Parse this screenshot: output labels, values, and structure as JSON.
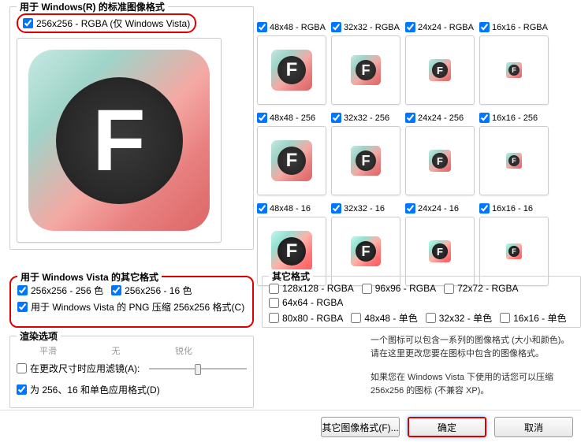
{
  "sections": {
    "standard": "用于 Windows(R) 的标准图像格式",
    "vista_other": "用于 Windows Vista 的其它格式",
    "other": "其它格式",
    "render": "渲染选项"
  },
  "checks": {
    "c256rgba": "256x256 - RGBA (仅 Windows Vista)",
    "c48rgba": "48x48 - RGBA",
    "c32rgba": "32x32 - RGBA",
    "c24rgba": "24x24 - RGBA",
    "c16rgba": "16x16 - RGBA",
    "c48_256": "48x48 - 256",
    "c32_256": "32x32 - 256",
    "c24_256": "24x24 - 256",
    "c16_256": "16x16 - 256",
    "c48_16": "48x48 - 16",
    "c32_16": "32x32 - 16",
    "c24_16": "24x24 - 16",
    "c16_16": "16x16 - 16",
    "v256_256": "256x256 - 256 色",
    "v256_16": "256x256 - 16 色",
    "v_png": "用于 Windows Vista 的 PNG 压缩 256x256 格式(C)",
    "o128rgba": "128x128 - RGBA",
    "o96rgba": "96x96 - RGBA",
    "o72rgba": "72x72 - RGBA",
    "o64rgba": "64x64 - RGBA",
    "o80rgba": "80x80 - RGBA",
    "o48mono": "48x48 - 单色",
    "o32mono": "32x32 - 单色",
    "o16mono": "16x16 - 单色",
    "filter": "在更改尺寸时应用滤镜(A):",
    "apply256": "为 256、16 和单色应用格式(D)"
  },
  "slider": {
    "left": "平滑",
    "mid": "无",
    "right": "锐化"
  },
  "help": {
    "line1": "一个图标可以包含一系列的图像格式 (大小和颜色)。请在这里更改您要在图标中包含的图像格式。",
    "line2": "如果您在 Windows Vista 下使用的话您可以压缩 256x256 的图标 (不兼容 XP)。"
  },
  "buttons": {
    "other": "其它图像格式(F)...",
    "ok": "确定",
    "cancel": "取消"
  },
  "icon_letter": "F"
}
